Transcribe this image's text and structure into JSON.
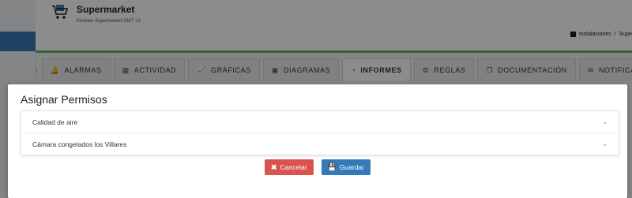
{
  "app": {
    "title": "Supermarket",
    "subtitle": "Kiconex Supermarket GMT +2"
  },
  "breadcrumb": {
    "items": [
      "Instalaciones",
      "/",
      "Supe"
    ]
  },
  "tabs": {
    "prev": "‹",
    "items": [
      {
        "label": "ALARMAS",
        "icon": "bell-icon",
        "active": false
      },
      {
        "label": "ACTIVIDAD",
        "icon": "calendar-icon",
        "active": false
      },
      {
        "label": "GRÁFICAS",
        "icon": "chart-icon",
        "active": false
      },
      {
        "label": "DIAGRAMAS",
        "icon": "image-icon",
        "active": false
      },
      {
        "label": "INFORMES",
        "icon": "pie-chart-icon",
        "active": true
      },
      {
        "label": "REGLAS",
        "icon": "gears-icon",
        "active": false
      },
      {
        "label": "DOCUMENTACIÓN",
        "icon": "documents-icon",
        "active": false
      },
      {
        "label": "NOTIFICACIONES",
        "icon": "envelope-icon",
        "active": false
      }
    ]
  },
  "modal": {
    "title": "Asignar Permisos",
    "accordion": [
      {
        "label": "Calidad de aire"
      },
      {
        "label": "Cámara congelados los Villares"
      }
    ],
    "cancel_label": "Cancelar",
    "save_label": "Guardar"
  },
  "colors": {
    "accent_green": "#5cb85c",
    "sidebar_active": "#3c79b4",
    "cancel": "#d9534f",
    "save": "#337ab7"
  }
}
